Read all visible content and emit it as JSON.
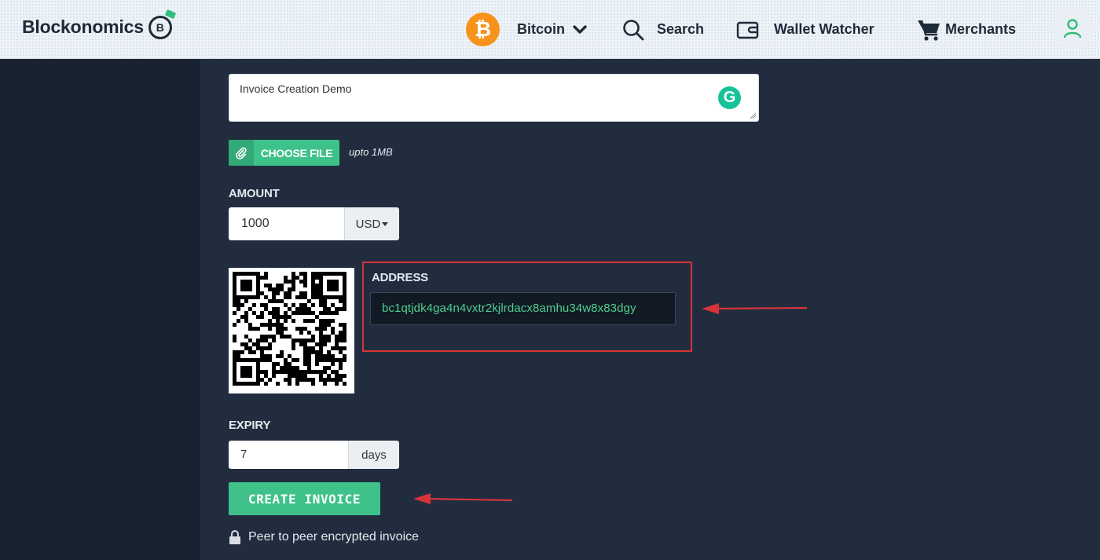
{
  "header": {
    "brand": "Blockonomics",
    "brand_logo_letter": "B",
    "coin_symbol": "₿",
    "coin_label": "Bitcoin",
    "search_label": "Search",
    "wallet_label": "Wallet Watcher",
    "merchants_label": "Merchants"
  },
  "form": {
    "description_value": "Invoice Creation Demo",
    "grammarly_letter": "G",
    "file_button_label": "CHOOSE FILE",
    "file_note": "upto 1MB",
    "amount_label": "AMOUNT",
    "amount_value": "1000",
    "currency": "USD",
    "address_label": "ADDRESS",
    "address_value": "bc1qtjdk4ga4n4vxtr2kjlrdacx8amhu34w8x83dgy",
    "expiry_label": "EXPIRY",
    "expiry_value": "7",
    "expiry_unit": "days",
    "create_button_label": "CREATE INVOICE",
    "secure_note": "Peer to peer encrypted invoice"
  },
  "colors": {
    "accent_green": "#3ec28a",
    "bitcoin_orange": "#f7931a",
    "annotation_red": "#d8333a",
    "page_bg": "#212d3e",
    "sidebar_bg": "#182230"
  },
  "icons": [
    "bitcoin-icon",
    "chevron-down-icon",
    "search-icon",
    "wallet-icon",
    "cart-icon",
    "user-icon",
    "grammarly-icon",
    "paperclip-icon",
    "lock-icon",
    "qr-code"
  ]
}
